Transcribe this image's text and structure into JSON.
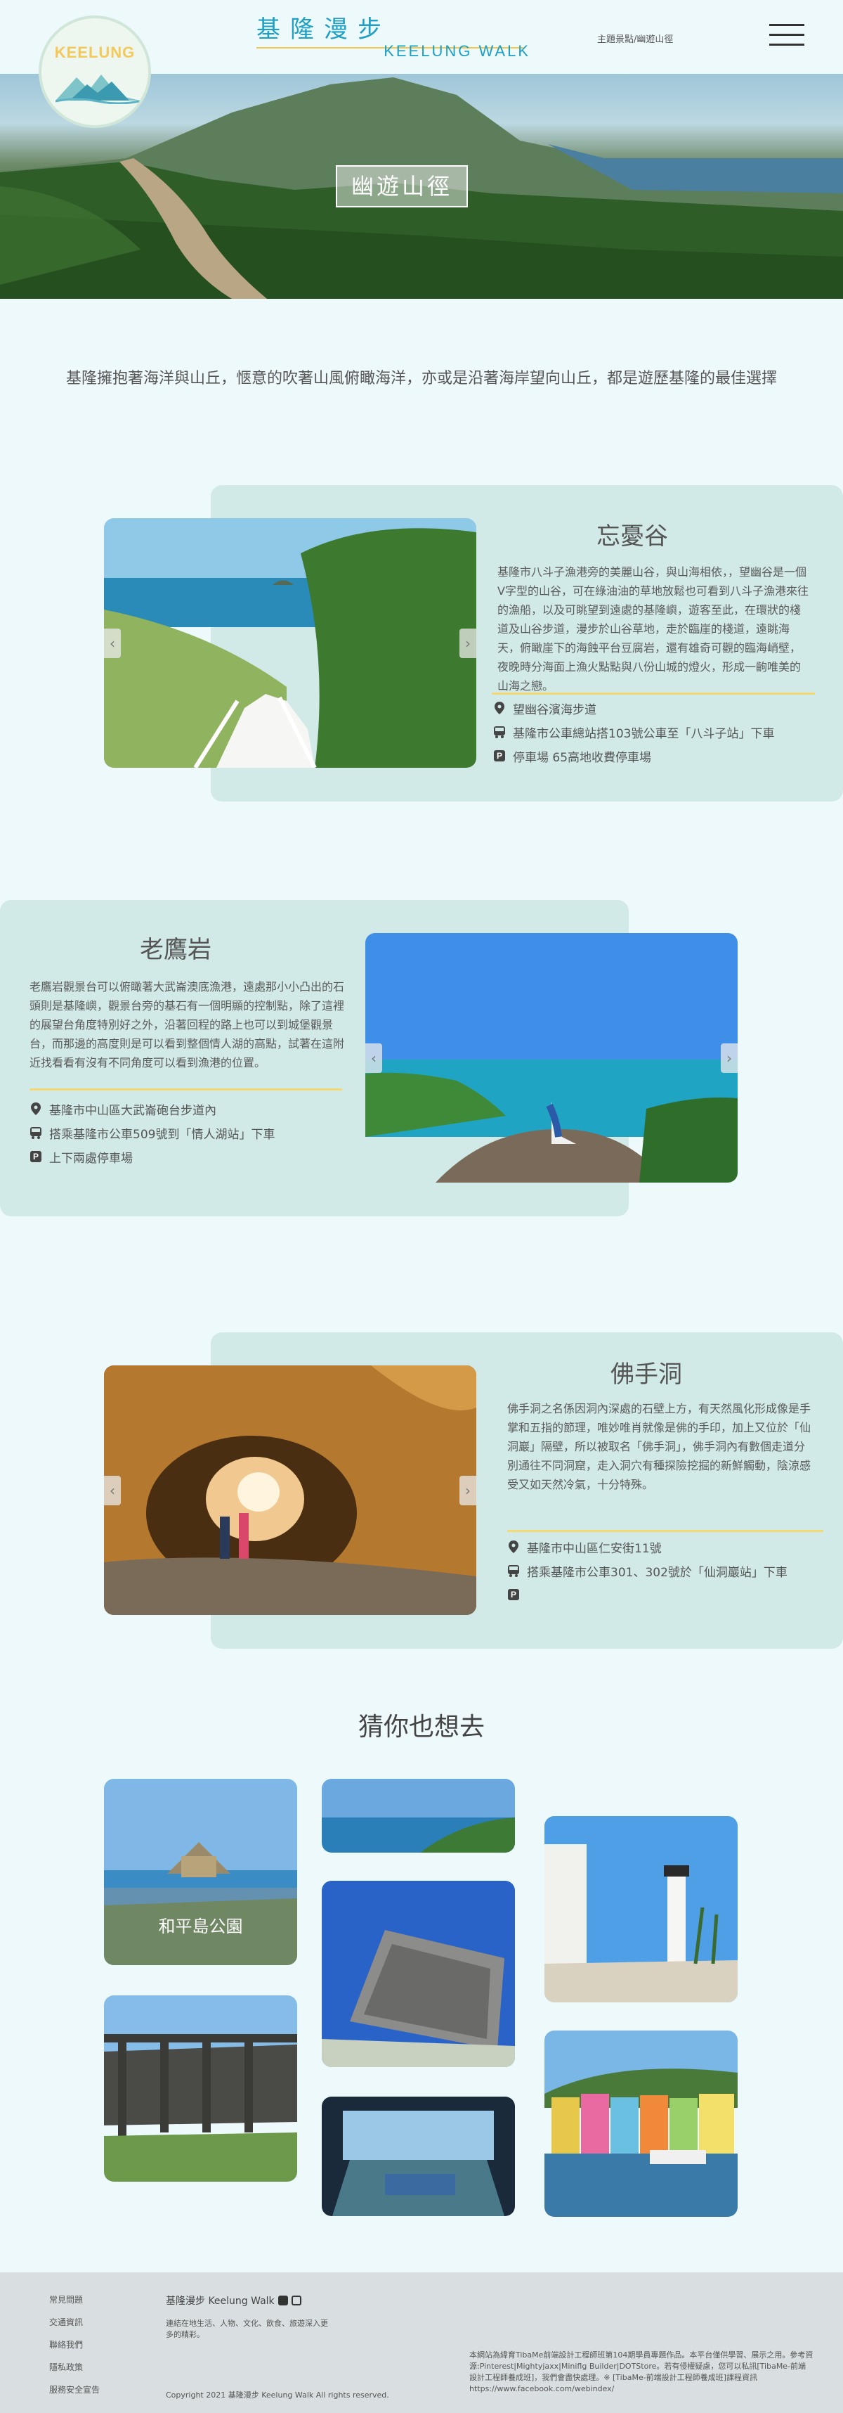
{
  "header": {
    "logo_text": "KEELUNG",
    "brand_zh": "基隆漫步",
    "brand_en": "KEELUNG WALK",
    "breadcrumb": "主題景點/幽遊山徑"
  },
  "hero": {
    "title": "幽遊山徑"
  },
  "intro": "基隆擁抱著海洋與山丘，愜意的吹著山風俯瞰海洋，亦或是沿著海岸望向山丘，都是遊歷基隆的最佳選擇",
  "features": [
    {
      "title": "忘憂谷",
      "description": "基隆市八斗子漁港旁的美麗山谷，與山海相依，，望幽谷是一個V字型的山谷，可在綠油油的草地放鬆也可看到八斗子漁港來往的漁船，以及可眺望到遠處的基隆嶼，遊客至此，在環狀的棧道及山谷步道，漫步於山谷草地，走於臨崖的棧道，遠眺海天，俯瞰崖下的海蝕平台豆腐岩，還有雄奇可觀的臨海峭壁，夜晚時分海面上漁火點點與八份山城的燈火，形成一齣唯美的山海之戀。",
      "location": "望幽谷濱海步道",
      "bus": "基隆市公車總站搭103號公車至「八斗子站」下車",
      "parking": "停車場 65高地收費停車場"
    },
    {
      "title": "老鷹岩",
      "description": "老鷹岩觀景台可以俯瞰著大武崙澳底漁港，遠處那小小凸出的石頭則是基隆嶼，觀景台旁的基石有一個明顯的控制點，除了這裡的展望台角度特別好之外，沿著回程的路上也可以到城堡觀景台，而那邊的高度則是可以看到整個情人湖的高點，試著在這附近找看看有沒有不同角度可以看到漁港的位置。",
      "location": "基隆市中山區大武崙砲台步道內",
      "bus": "搭乘基隆市公車509號到「情人湖站」下車",
      "parking": "上下兩處停車場"
    },
    {
      "title": "佛手洞",
      "description": "佛手洞之名係因洞內深處的石壁上方，有天然風化形成像是手掌和五指的節理，唯妙唯肖就像是佛的手印，加上又位於「仙洞巖」隔壁，所以被取名「佛手洞」，佛手洞內有數個走道分別通往不同洞窟，走入洞穴有種探險挖掘的新鮮觸動，陰涼感受又如天然冷氣，十分特殊。",
      "location": "基隆市中山區仁安街11號",
      "bus": "搭乘基隆市公車301、302號於「仙洞巖站」下車",
      "parking": ""
    }
  ],
  "suggest": {
    "title": "猜你也想去",
    "tile_label": "和平島公園"
  },
  "footer": {
    "links": [
      "常見問題",
      "交通資訊",
      "聯絡我們",
      "隱私政策",
      "服務安全宣告"
    ],
    "brand": "基隆漫步 Keelung Walk",
    "about": "連結在地生活、人物、文化、飲食、旅遊深入更多的精彩。",
    "copyright": "Copyright  2021 基隆漫步 Keelung Walk All rights reserved.",
    "disclaimer": "本網站為緯育TibaMe前端設計工程師班第104期學員專題作品。本平台僅供學習、展示之用。參考資源:Pinterest|Mightyjaxx|Miniflg Builder|DOTStore。若有侵權疑慮，您可以私訊[TibaMe-前端設計工程師養成班]，我們會盡快處理。※ [TibaMe-前端設計工程師養成班]課程資訊https://www.facebook.com/webindex/"
  },
  "colors": {
    "brand": "#1e9fc4",
    "accent": "#f1c84b",
    "panel": "#d1e9e7",
    "page": "#eef9fc"
  }
}
